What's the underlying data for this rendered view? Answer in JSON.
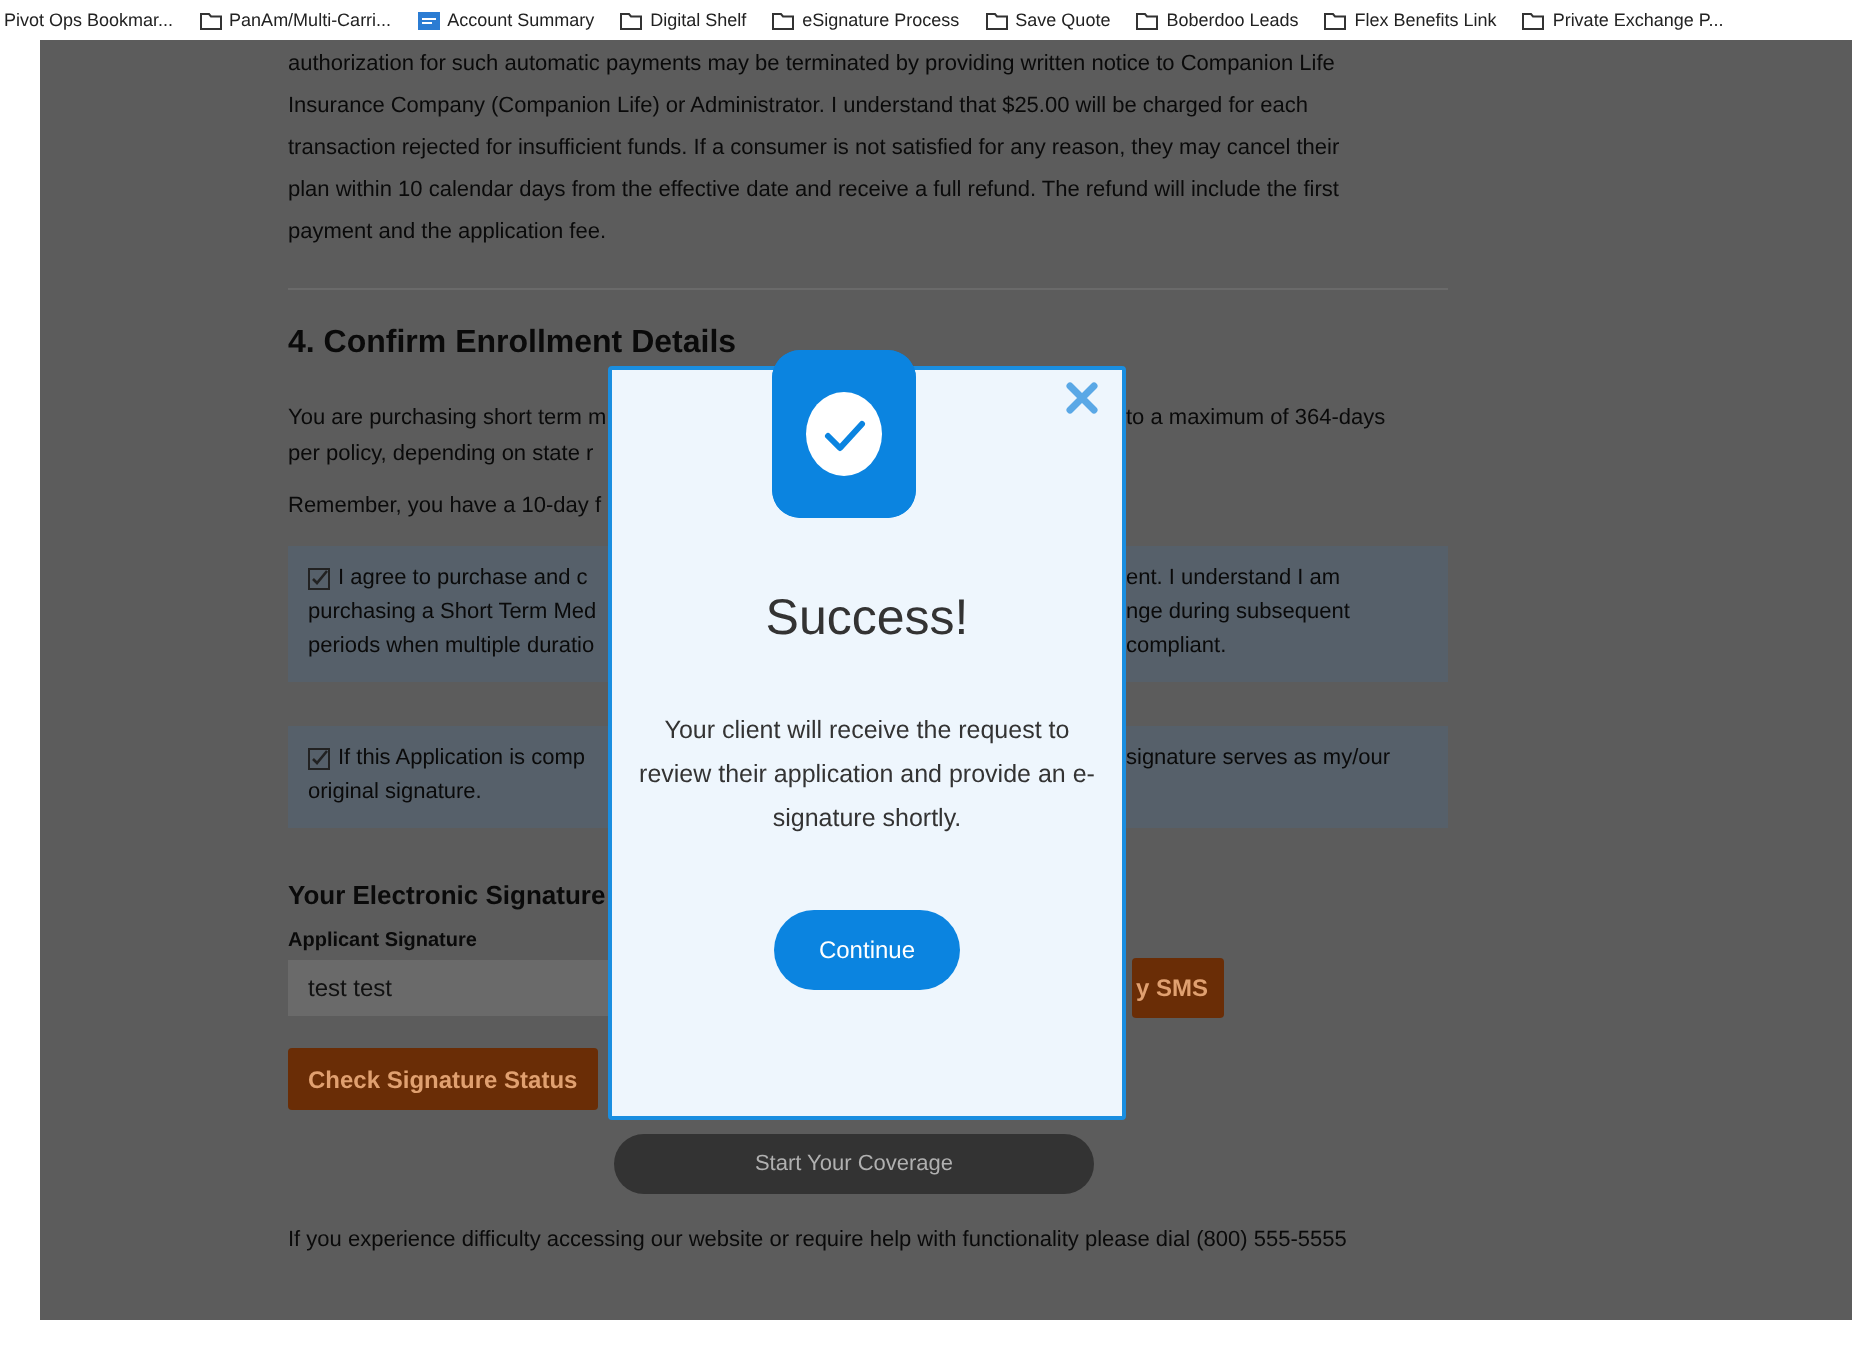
{
  "bookmarks": [
    {
      "label": "Pivot Ops Bookmar...",
      "kind": "cut"
    },
    {
      "label": "PanAm/Multi-Carri...",
      "kind": "folder"
    },
    {
      "label": "Account Summary",
      "kind": "app"
    },
    {
      "label": "Digital Shelf",
      "kind": "folder"
    },
    {
      "label": "eSignature Process",
      "kind": "folder"
    },
    {
      "label": "Save Quote",
      "kind": "folder"
    },
    {
      "label": "Boberdoo Leads",
      "kind": "folder"
    },
    {
      "label": "Flex Benefits Link",
      "kind": "folder"
    },
    {
      "label": "Private Exchange P...",
      "kind": "folder"
    }
  ],
  "page": {
    "intro_paragraph": "authorization for such automatic payments may be terminated by providing written notice to Companion Life Insurance Company (Companion Life) or Administrator. I understand that $25.00 will be charged for each transaction rejected for insufficient funds. If a consumer is not satisfied for any reason, they may cancel their plan within 10 calendar days from the effective date and receive a full refund. The refund will include the first payment and the application fee.",
    "section_heading": "4. Confirm Enrollment Details",
    "intro_lines": [
      {
        "left": "You are purchasing short term m",
        "right": "to a maximum of 364-days"
      },
      {
        "left": "per policy, depending on state r"
      }
    ],
    "reminder": "Remember, you have a 10-day f",
    "agreements": [
      {
        "checked": true,
        "lines": [
          {
            "left": "I agree to purchase and c",
            "right": "ent. I understand I am"
          },
          {
            "left": "purchasing a Short Term Med",
            "right": "nge during subsequent"
          },
          {
            "left": "periods when multiple duratio",
            "right": "compliant."
          }
        ]
      },
      {
        "checked": true,
        "lines": [
          {
            "left": "If this Application is comp",
            "right": "signature serves as my/our"
          },
          {
            "left": "original signature."
          }
        ]
      }
    ],
    "signature_heading": "Your Electronic Signature",
    "signature_label": "Applicant Signature",
    "signature_value": "test test",
    "sms_button": "y SMS",
    "check_status_button": "Check Signature Status",
    "start_button": "Start Your Coverage",
    "help_text": "If you experience difficulty accessing our website or require help with functionality please dial (800) 555-5555"
  },
  "modal": {
    "title": "Success!",
    "message": "Your client will receive the request to review their application and provide an e-signature shortly.",
    "button": "Continue"
  }
}
